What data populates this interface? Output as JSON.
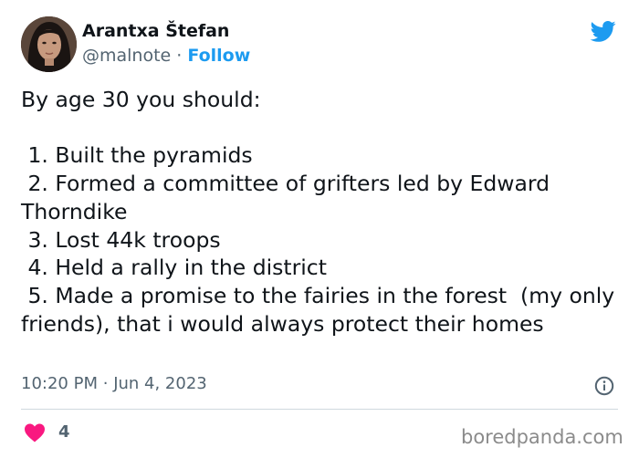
{
  "author": {
    "name": "Arantxa Štefan",
    "handle": "@malnote",
    "separator": "·",
    "follow_label": "Follow"
  },
  "tweet": {
    "text": "By age 30 you should:\n\n 1. Built the pyramids\n 2. Formed a committee of grifters led by Edward Thorndike\n 3. Lost 44k troops\n 4. Held a rally in the district\n 5. Made a promise to the fairies in the forest  (my only friends), that i would always protect their homes",
    "time": "10:20 PM",
    "date_separator": "·",
    "date": "Jun 4, 2023"
  },
  "engagement": {
    "like_count": "4"
  },
  "watermark": "boredpanda.com",
  "icons": {
    "platform": "twitter-bird-icon",
    "info": "info-icon",
    "like": "heart-icon"
  },
  "colors": {
    "accent": "#1d9bf0",
    "like": "#f91880",
    "secondary_text": "#536471"
  }
}
